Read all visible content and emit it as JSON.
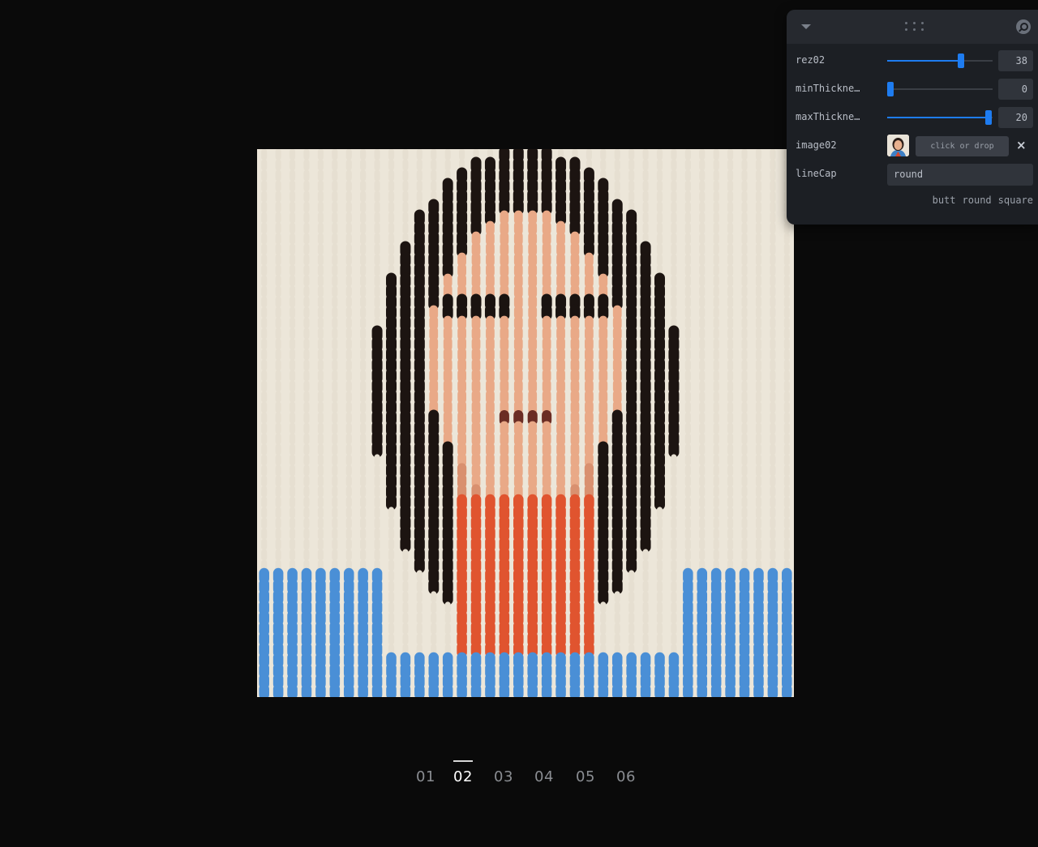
{
  "panel": {
    "controls": [
      {
        "label": "rez02",
        "type": "slider",
        "value": "38",
        "fraction": 0.7
      },
      {
        "label": "minThickne…",
        "type": "slider",
        "value": "0",
        "fraction": 0.0
      },
      {
        "label": "maxThickne…",
        "type": "slider",
        "value": "20",
        "fraction": 1.0
      }
    ],
    "image": {
      "label": "image02",
      "button": "click or drop",
      "clear": "×"
    },
    "linecap": {
      "label": "lineCap",
      "value": "round",
      "options": [
        "butt",
        "round",
        "square"
      ]
    },
    "icons": [
      "chevron-down-icon",
      "drag-grip-icon",
      "search-icon",
      "close-icon"
    ]
  },
  "pagination": {
    "pages": [
      "01",
      "02",
      "03",
      "04",
      "05",
      "06"
    ],
    "active": "02"
  },
  "colors": {
    "accent": "#1e7cf0",
    "background": "#0a0a0a",
    "panel": "#1c1f24"
  }
}
